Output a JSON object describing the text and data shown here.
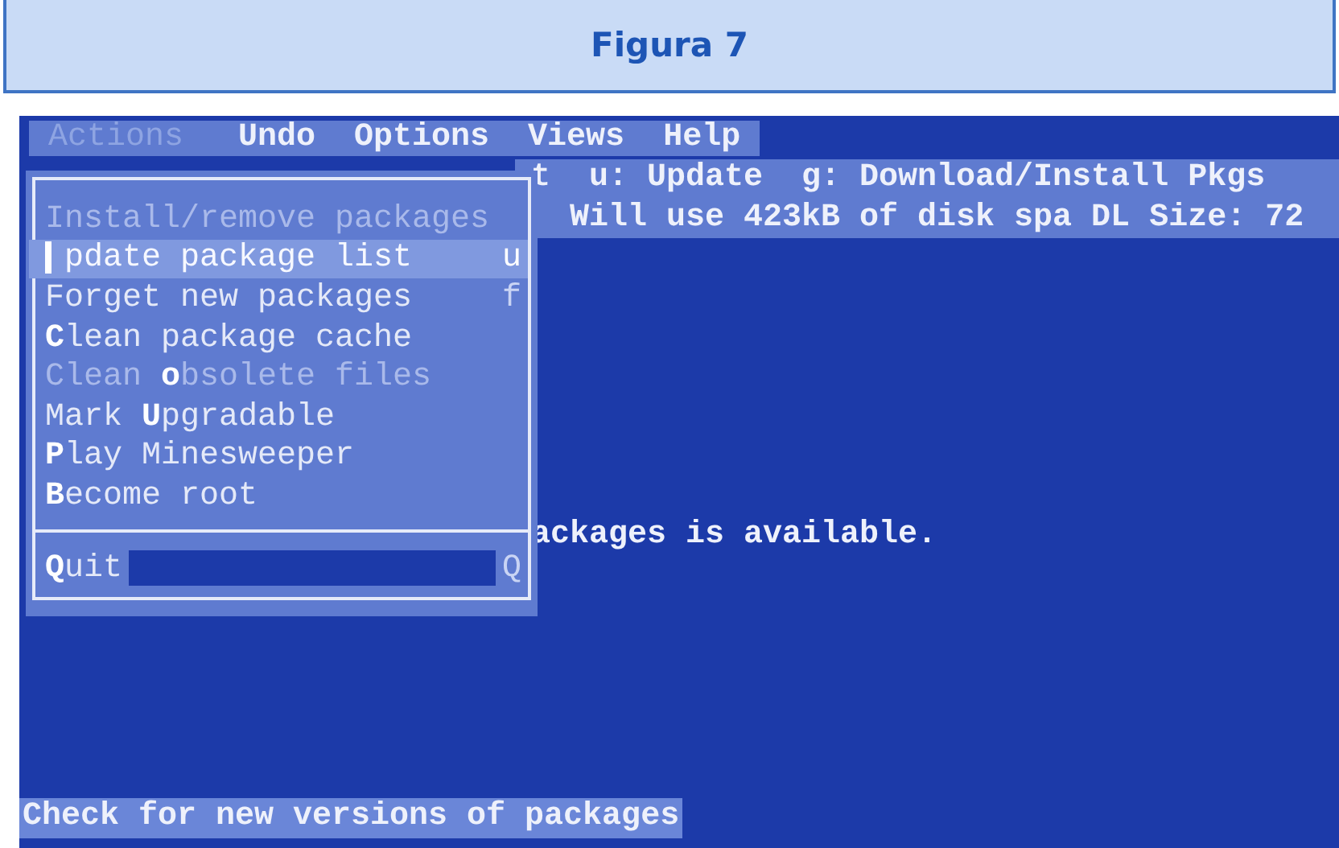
{
  "figure_title": "Figura 7",
  "menubar": [
    {
      "label": "Actions",
      "selected": true
    },
    {
      "label": "Undo",
      "selected": false
    },
    {
      "label": "Options",
      "selected": false
    },
    {
      "label": "Views",
      "selected": false
    },
    {
      "label": "Help",
      "selected": false
    }
  ],
  "background_lines": [
    {
      "kind": "info",
      "text": "t  u: Update  g: Download/Install Pkgs"
    },
    {
      "kind": "info",
      "text": "  Will use 423kB of disk spa DL Size: 72"
    },
    {
      "kind": "plain",
      "text": "ackages is available."
    }
  ],
  "menu": {
    "items": [
      {
        "pre": "Install/remove packages",
        "disabled": true,
        "selected": false
      },
      {
        "post": "pdate package list",
        "shortcut": "u",
        "disabled": false,
        "selected": true
      },
      {
        "post": "Forget new packages",
        "shortcut": "f",
        "disabled": false,
        "selected": false
      },
      {
        "key": "C",
        "post": "lean package cache",
        "disabled": false,
        "selected": false
      },
      {
        "pre": "Clean ",
        "key": "o",
        "post": "bsolete files",
        "disabled": true,
        "selected": false
      },
      {
        "pre": "Mark ",
        "key": "U",
        "post": "pgradable",
        "disabled": false,
        "selected": false
      },
      {
        "key": "P",
        "post": "lay Minesweeper",
        "disabled": false,
        "selected": false
      },
      {
        "key": "B",
        "post": "ecome root",
        "disabled": false,
        "selected": false
      }
    ],
    "footer_item": {
      "key": "Q",
      "post": "uit",
      "shortcut": "Q"
    }
  },
  "status_bar": "Check for new versions of packages"
}
